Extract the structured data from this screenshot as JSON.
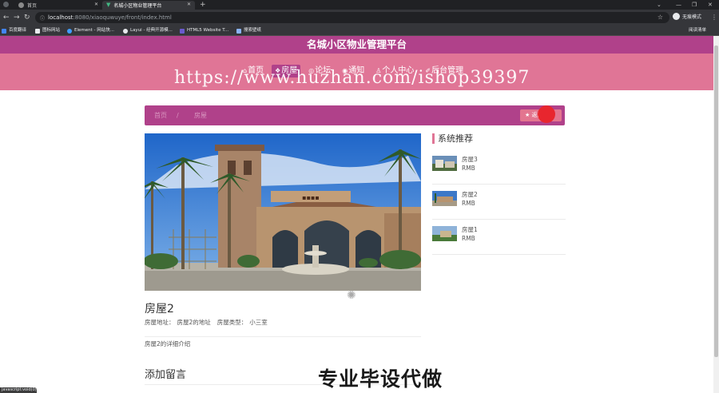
{
  "browser": {
    "tabs": [
      {
        "title": "首页"
      },
      {
        "title": "名城小区物业管理平台"
      }
    ],
    "new_tab": "+",
    "url_host": "localhost",
    "url_path": ":8080/xiaoquwuye/front/index.html",
    "profile_label": "无痕模式",
    "bookmarks": [
      {
        "label": "百度翻译",
        "icon": "translate-icon"
      },
      {
        "label": "图标网站",
        "icon": "folder-icon"
      },
      {
        "label": "Element - 网站快...",
        "icon": "element-icon"
      },
      {
        "label": "Layui - 经典开源模...",
        "icon": "layui-icon"
      },
      {
        "label": "HTML5 Website T...",
        "icon": "html5-icon"
      },
      {
        "label": "搜索壁纸",
        "icon": "image-icon"
      }
    ],
    "reading_list": "阅读清单"
  },
  "site": {
    "title": "名城小区物业管理平台",
    "nav": [
      {
        "label": "首页",
        "icon": "home-icon",
        "active": false
      },
      {
        "label": "房屋",
        "icon": "house-icon",
        "active": true
      },
      {
        "label": "论坛",
        "icon": "forum-icon",
        "active": false
      },
      {
        "label": "通知",
        "icon": "notice-icon",
        "active": false
      },
      {
        "label": "个人中心",
        "icon": "user-icon",
        "active": false
      },
      {
        "label": "后台管理",
        "icon": "admin-icon",
        "active": false
      }
    ],
    "watermark_url": "https://www.huzhan.com/ishop39397"
  },
  "breadcrumb": {
    "home": "首页",
    "sep": "/",
    "current": "房屋",
    "back_label": "返回",
    "back_icon": "star-icon"
  },
  "house": {
    "title": "房屋2",
    "address_label": "房屋地址：",
    "address": "房屋2的地址",
    "type_label": "房屋类型：",
    "type": "小三室",
    "description": "房屋2的详细介绍"
  },
  "comments": {
    "title": "添加留言"
  },
  "sidebar": {
    "title": "系统推荐",
    "items": [
      {
        "name": "房屋3",
        "price": "RMB"
      },
      {
        "name": "房屋2",
        "price": "RMB"
      },
      {
        "name": "房屋1",
        "price": "RMB"
      }
    ]
  },
  "overlay": {
    "watermark_ad": "专业毕设代做",
    "status_url": "javascript:void(0)"
  },
  "colors": {
    "primary": "#b0418a",
    "secondary": "#e07596"
  }
}
